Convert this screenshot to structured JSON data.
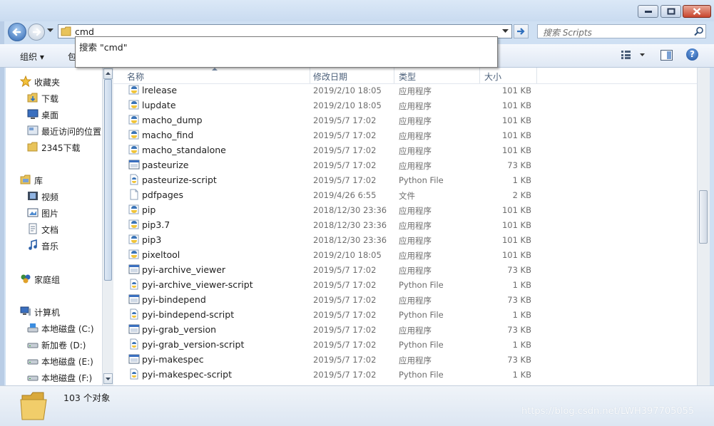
{
  "window": {
    "address_text": "cmd",
    "search_placeholder": "搜索 Scripts",
    "autocomplete_item": "搜索 \"cmd\""
  },
  "toolbar": {
    "organize_label": "组织 ▾",
    "include_label": "包",
    "view_icon": "views-icon",
    "preview_icon": "preview-pane-icon",
    "help_label": "?"
  },
  "nav": {
    "favorites": {
      "label": "收藏夹",
      "icon": "star-icon"
    },
    "fav_items": [
      {
        "label": "下载",
        "icon": "downloads-folder-icon"
      },
      {
        "label": "桌面",
        "icon": "desktop-icon"
      },
      {
        "label": "最近访问的位置",
        "icon": "recent-places-icon"
      },
      {
        "label": "2345下载",
        "icon": "folder-icon"
      }
    ],
    "libraries": {
      "label": "库",
      "icon": "library-icon"
    },
    "lib_items": [
      {
        "label": "视频",
        "icon": "video-library-icon"
      },
      {
        "label": "图片",
        "icon": "pictures-library-icon"
      },
      {
        "label": "文档",
        "icon": "documents-library-icon"
      },
      {
        "label": "音乐",
        "icon": "music-library-icon"
      }
    ],
    "homegroup": {
      "label": "家庭组",
      "icon": "homegroup-icon"
    },
    "computer": {
      "label": "计算机",
      "icon": "computer-icon"
    },
    "drives": [
      {
        "label": "本地磁盘 (C:)",
        "icon": "system-drive-icon"
      },
      {
        "label": "新加卷 (D:)",
        "icon": "drive-icon"
      },
      {
        "label": "本地磁盘 (E:)",
        "icon": "drive-icon"
      },
      {
        "label": "本地磁盘 (F:)",
        "icon": "drive-icon"
      }
    ]
  },
  "columns": {
    "name": "名称",
    "date": "修改日期",
    "type": "类型",
    "size": "大小"
  },
  "files": [
    {
      "name": "lrelease",
      "date": "2019/2/10 18:05",
      "type": "应用程序",
      "size": "101 KB",
      "icon": "python-exe-icon"
    },
    {
      "name": "lupdate",
      "date": "2019/2/10 18:05",
      "type": "应用程序",
      "size": "101 KB",
      "icon": "python-exe-icon"
    },
    {
      "name": "macho_dump",
      "date": "2019/5/7 17:02",
      "type": "应用程序",
      "size": "101 KB",
      "icon": "python-exe-icon"
    },
    {
      "name": "macho_find",
      "date": "2019/5/7 17:02",
      "type": "应用程序",
      "size": "101 KB",
      "icon": "python-exe-icon"
    },
    {
      "name": "macho_standalone",
      "date": "2019/5/7 17:02",
      "type": "应用程序",
      "size": "101 KB",
      "icon": "python-exe-icon"
    },
    {
      "name": "pasteurize",
      "date": "2019/5/7 17:02",
      "type": "应用程序",
      "size": "73 KB",
      "icon": "window-exe-icon"
    },
    {
      "name": "pasteurize-script",
      "date": "2019/5/7 17:02",
      "type": "Python File",
      "size": "1 KB",
      "icon": "python-file-icon"
    },
    {
      "name": "pdfpages",
      "date": "2019/4/26 6:55",
      "type": "文件",
      "size": "2 KB",
      "icon": "blank-file-icon"
    },
    {
      "name": "pip",
      "date": "2018/12/30 23:36",
      "type": "应用程序",
      "size": "101 KB",
      "icon": "python-exe-icon"
    },
    {
      "name": "pip3.7",
      "date": "2018/12/30 23:36",
      "type": "应用程序",
      "size": "101 KB",
      "icon": "python-exe-icon"
    },
    {
      "name": "pip3",
      "date": "2018/12/30 23:36",
      "type": "应用程序",
      "size": "101 KB",
      "icon": "python-exe-icon"
    },
    {
      "name": "pixeltool",
      "date": "2019/2/10 18:05",
      "type": "应用程序",
      "size": "101 KB",
      "icon": "python-exe-icon"
    },
    {
      "name": "pyi-archive_viewer",
      "date": "2019/5/7 17:02",
      "type": "应用程序",
      "size": "73 KB",
      "icon": "window-exe-icon"
    },
    {
      "name": "pyi-archive_viewer-script",
      "date": "2019/5/7 17:02",
      "type": "Python File",
      "size": "1 KB",
      "icon": "python-file-icon"
    },
    {
      "name": "pyi-bindepend",
      "date": "2019/5/7 17:02",
      "type": "应用程序",
      "size": "73 KB",
      "icon": "window-exe-icon"
    },
    {
      "name": "pyi-bindepend-script",
      "date": "2019/5/7 17:02",
      "type": "Python File",
      "size": "1 KB",
      "icon": "python-file-icon"
    },
    {
      "name": "pyi-grab_version",
      "date": "2019/5/7 17:02",
      "type": "应用程序",
      "size": "73 KB",
      "icon": "window-exe-icon"
    },
    {
      "name": "pyi-grab_version-script",
      "date": "2019/5/7 17:02",
      "type": "Python File",
      "size": "1 KB",
      "icon": "python-file-icon"
    },
    {
      "name": "pyi-makespec",
      "date": "2019/5/7 17:02",
      "type": "应用程序",
      "size": "73 KB",
      "icon": "window-exe-icon"
    },
    {
      "name": "pyi-makespec-script",
      "date": "2019/5/7 17:02",
      "type": "Python File",
      "size": "1 KB",
      "icon": "python-file-icon"
    }
  ],
  "status": {
    "count_text": "103 个对象",
    "watermark": "https://blog.csdn.net/LWH397705055"
  }
}
